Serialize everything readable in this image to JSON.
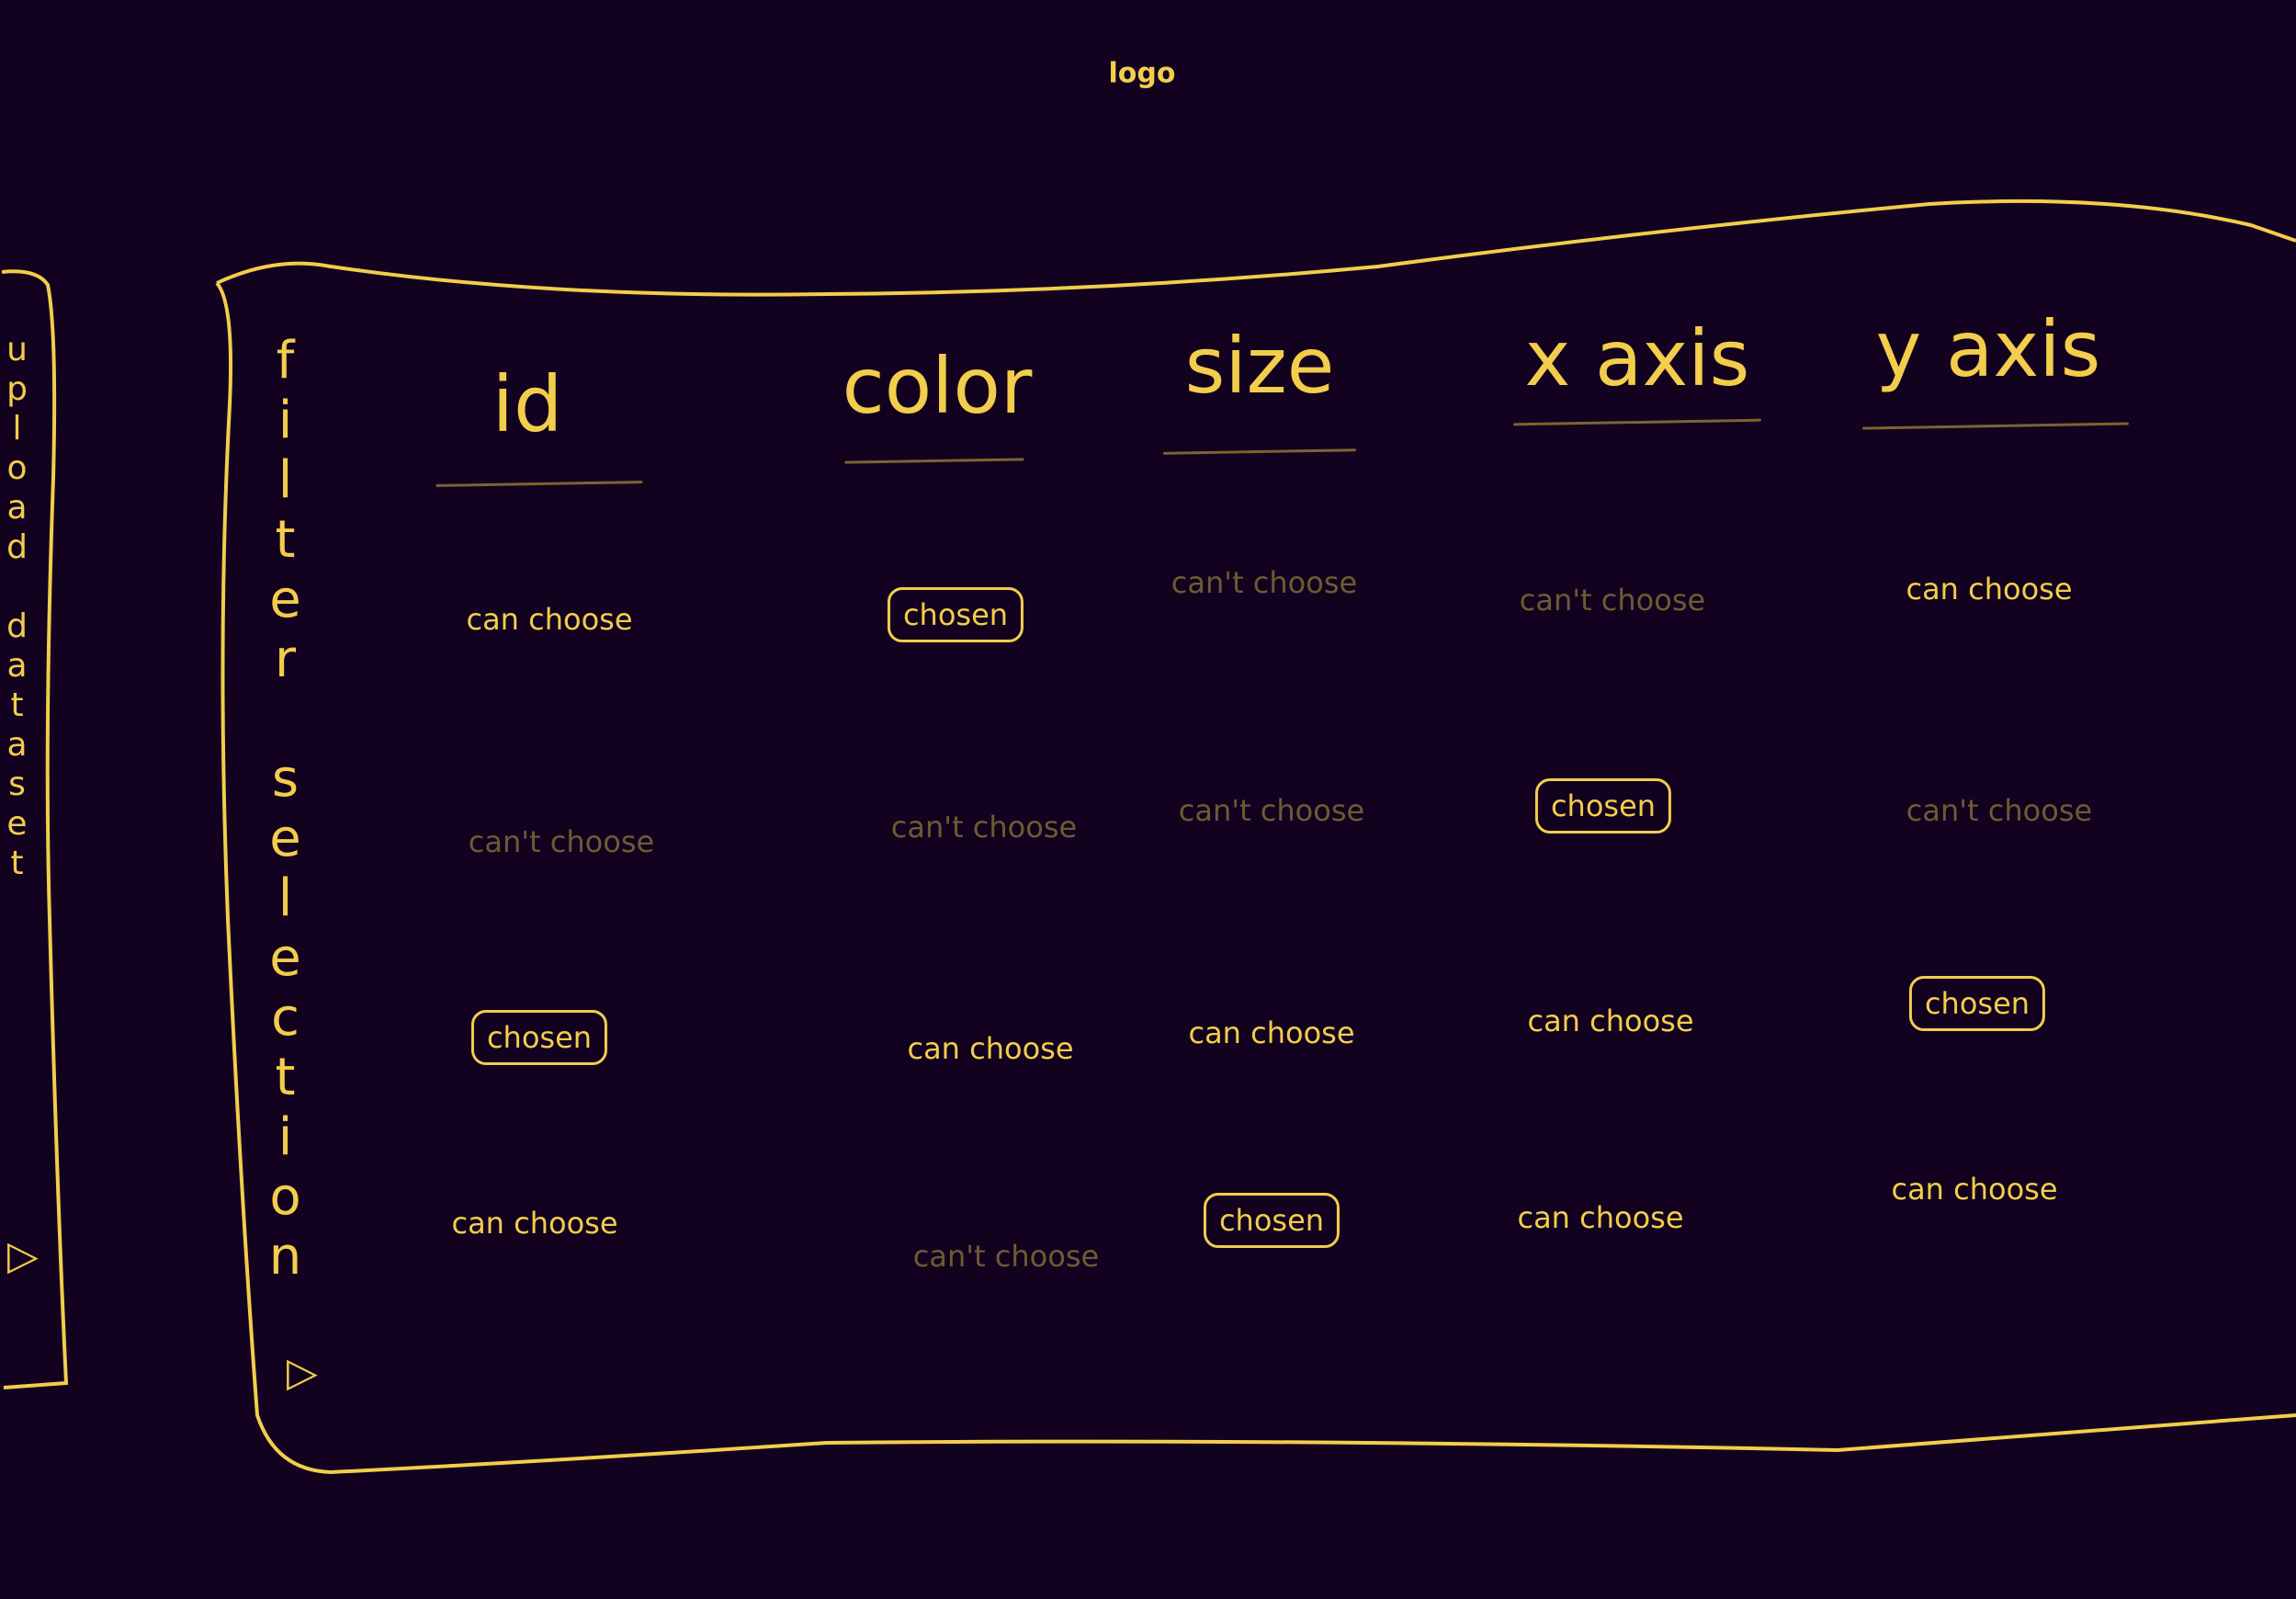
{
  "logo": "logo",
  "left_panel": {
    "label": "upload dataset",
    "submit_icon": "play-triangle-icon"
  },
  "main_panel": {
    "label": "filter selection",
    "submit_icon": "play-triangle-icon"
  },
  "state_labels": {
    "can": "can choose",
    "cant": "can't choose",
    "chosen": "chosen"
  },
  "columns": [
    {
      "label": "id",
      "cells": [
        "can",
        "cant",
        "chosen",
        "can"
      ]
    },
    {
      "label": "color",
      "cells": [
        "chosen",
        "cant",
        "can",
        "cant"
      ]
    },
    {
      "label": "size",
      "cells": [
        "cant",
        "cant",
        "can",
        "chosen"
      ]
    },
    {
      "label": "x axis",
      "cells": [
        "cant",
        "chosen",
        "can",
        "can"
      ]
    },
    {
      "label": "y axis",
      "cells": [
        "can",
        "cant",
        "chosen",
        "can"
      ]
    }
  ],
  "colors": {
    "background": "#12021f",
    "accent": "#f3cd4c",
    "disabled": "#6e5a32"
  }
}
